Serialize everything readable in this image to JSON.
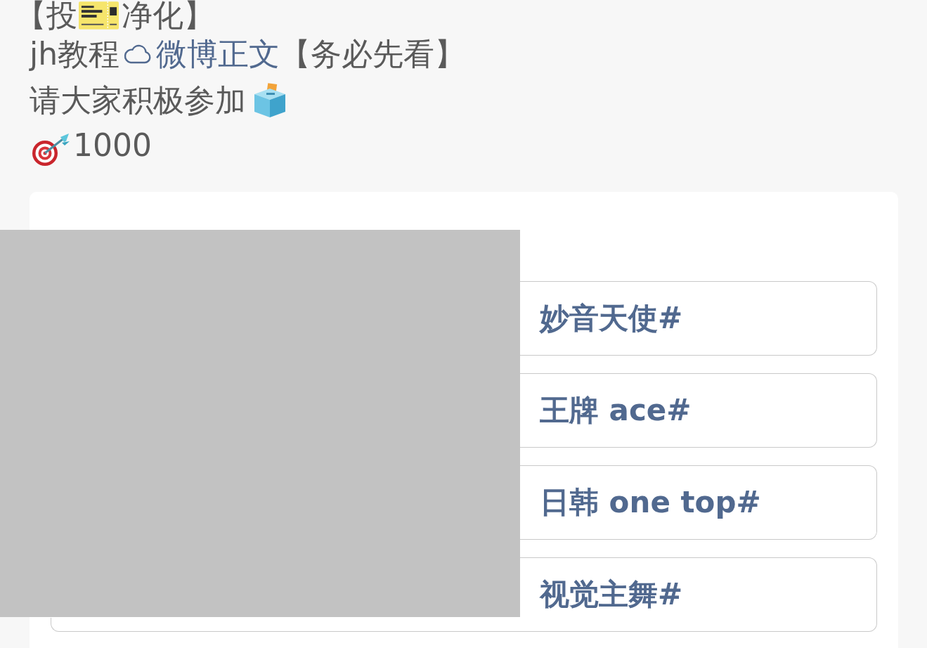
{
  "post_text": {
    "title_line": {
      "start": "【投",
      "end": "净化】"
    },
    "tutorial_line": {
      "text": "jh教程",
      "link": "微博正文",
      "note": "【务必先看】"
    },
    "invite_line": {
      "text": "请大家积极参加"
    },
    "target_line": {
      "text": "1000"
    }
  },
  "poll": {
    "options": [
      {
        "text": "妙音天使#",
        "selected": false
      },
      {
        "text": "王牌 ace#",
        "selected": false
      },
      {
        "text": "日韩 one top#",
        "selected": false
      },
      {
        "text": "视觉主舞#",
        "selected": false
      }
    ]
  }
}
